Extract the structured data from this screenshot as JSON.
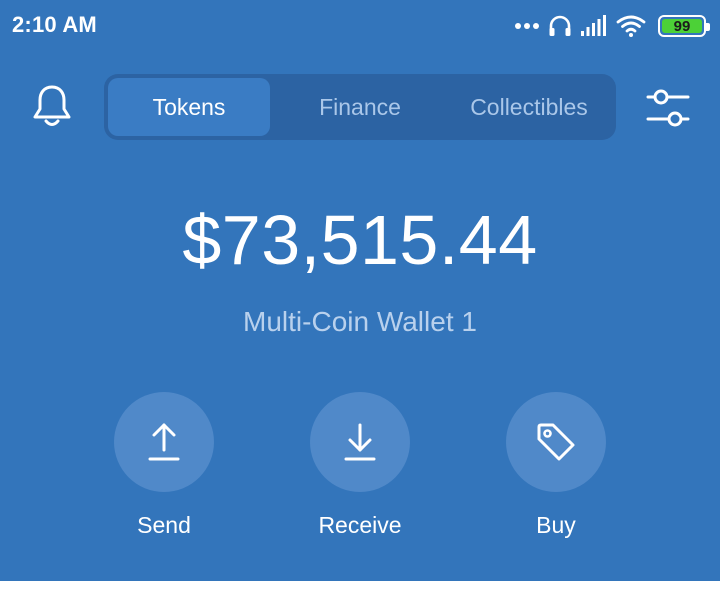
{
  "status_bar": {
    "time": "2:10 AM",
    "battery_level": "99",
    "battery_fraction": 0.99,
    "icons": [
      "more-dots-icon",
      "headphones-icon",
      "signal-icon",
      "wifi-icon",
      "battery-icon"
    ]
  },
  "header": {
    "bell_icon": "bell-icon",
    "filter_icon": "sliders-icon",
    "tabs": [
      {
        "label": "Tokens",
        "active": true
      },
      {
        "label": "Finance",
        "active": false
      },
      {
        "label": "Collectibles",
        "active": false
      }
    ]
  },
  "wallet": {
    "balance": "$73,515.44",
    "name": "Multi-Coin Wallet 1"
  },
  "actions": [
    {
      "label": "Send",
      "icon": "upload-arrow-icon"
    },
    {
      "label": "Receive",
      "icon": "download-arrow-icon"
    },
    {
      "label": "Buy",
      "icon": "price-tag-icon"
    }
  ],
  "colors": {
    "background": "#3375bb",
    "segment_bg": "#2c63a3",
    "active_tab": "#3a7cc4",
    "action_circle": "#5089c9",
    "battery_fill": "#4cd137"
  }
}
